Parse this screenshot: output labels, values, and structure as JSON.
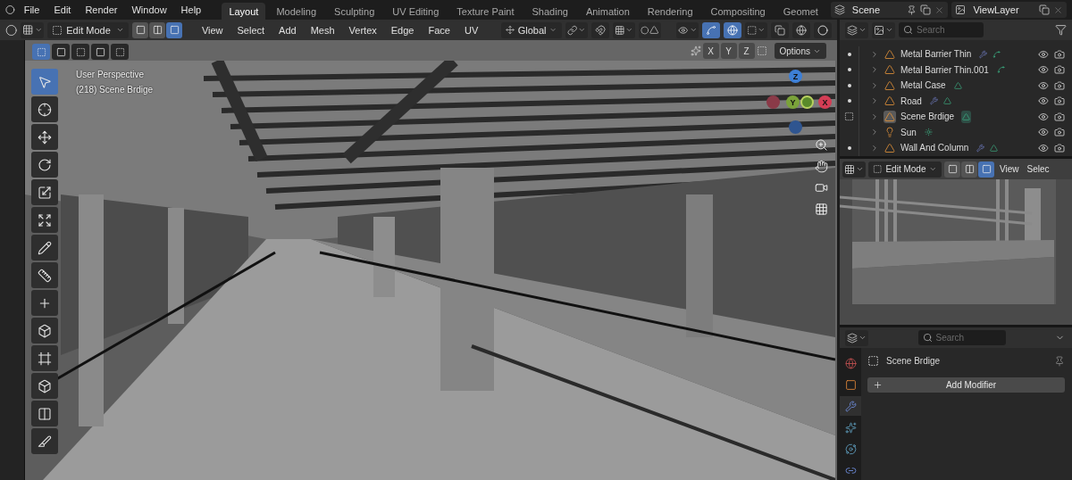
{
  "menus": [
    "File",
    "Edit",
    "Render",
    "Window",
    "Help"
  ],
  "workspaces": [
    {
      "label": "Layout",
      "selected": true
    },
    {
      "label": "Modeling",
      "selected": false
    },
    {
      "label": "Sculpting",
      "selected": false
    },
    {
      "label": "UV Editing",
      "selected": false
    },
    {
      "label": "Texture Paint",
      "selected": false
    },
    {
      "label": "Shading",
      "selected": false
    },
    {
      "label": "Animation",
      "selected": false
    },
    {
      "label": "Rendering",
      "selected": false
    },
    {
      "label": "Compositing",
      "selected": false
    },
    {
      "label": "Geomet",
      "selected": false
    }
  ],
  "scene": {
    "name": "Scene"
  },
  "view_layer": {
    "name": "ViewLayer"
  },
  "viewport_header": {
    "mode": "Edit Mode",
    "select_modes": [
      {
        "kind": "vertex",
        "selected": false
      },
      {
        "kind": "edge",
        "selected": false
      },
      {
        "kind": "face",
        "selected": true
      }
    ],
    "menus": [
      "View",
      "Select",
      "Add",
      "Mesh",
      "Vertex",
      "Edge",
      "Face",
      "UV"
    ],
    "orientation": "Global"
  },
  "viewport": {
    "view_name": "User Perspective",
    "object_label": "(218) Scene Brdige",
    "axes": [
      "X",
      "Y",
      "Z"
    ],
    "options": "Options",
    "gizmo": {
      "z": "Z",
      "y": "Y",
      "x": "X"
    },
    "tools": [
      {
        "kind": "select",
        "selected": true
      },
      {
        "kind": "cursor",
        "selected": false
      },
      {
        "kind": "move",
        "selected": false
      },
      {
        "kind": "rotate",
        "selected": false
      },
      {
        "kind": "scale",
        "selected": false
      },
      {
        "kind": "transform",
        "selected": false
      },
      {
        "kind": "annotate",
        "selected": false
      },
      {
        "kind": "measure",
        "selected": false
      },
      {
        "kind": "add",
        "selected": false
      },
      {
        "kind": "extrude",
        "selected": false
      },
      {
        "kind": "inset",
        "selected": false
      },
      {
        "kind": "bevel",
        "selected": false
      },
      {
        "kind": "loopcut",
        "selected": false
      },
      {
        "kind": "knife",
        "selected": false
      }
    ]
  },
  "outliner": {
    "search": {
      "placeholder": "Search"
    },
    "items": [
      {
        "name": "Metal Barrier Thin",
        "kind": "mesh",
        "editable": true,
        "in_edit_mode": false,
        "icons": [
          {
            "kind": "wrench"
          },
          {
            "kind": "curve"
          }
        ],
        "selected": false
      },
      {
        "name": "Metal Barrier Thin.001",
        "kind": "mesh",
        "editable": true,
        "in_edit_mode": false,
        "icons": [
          {
            "kind": "curve"
          }
        ],
        "selected": false
      },
      {
        "name": "Metal Case",
        "kind": "mesh",
        "editable": true,
        "in_edit_mode": false,
        "icons": [
          {
            "kind": "mesh"
          }
        ],
        "selected": false
      },
      {
        "name": "Road",
        "kind": "mesh",
        "editable": true,
        "in_edit_mode": false,
        "icons": [
          {
            "kind": "wrench"
          },
          {
            "kind": "mesh"
          }
        ],
        "selected": false
      },
      {
        "name": "Scene Brdige",
        "kind": "mesh",
        "editable": false,
        "in_edit_mode": true,
        "icons": [
          {
            "kind": "mesh"
          }
        ],
        "selected": true
      },
      {
        "name": "Sun",
        "kind": "light",
        "editable": false,
        "in_edit_mode": false,
        "icons": [
          {
            "kind": "sun"
          }
        ],
        "selected": false
      },
      {
        "name": "Wall And Column",
        "kind": "mesh",
        "editable": true,
        "in_edit_mode": false,
        "icons": [
          {
            "kind": "wrench"
          },
          {
            "kind": "mesh"
          }
        ],
        "selected": false
      }
    ]
  },
  "preview": {
    "mode": "Edit Mode",
    "select_modes": [
      {
        "kind": "vertex",
        "selected": false
      },
      {
        "kind": "edge",
        "selected": false
      },
      {
        "kind": "face",
        "selected": true
      }
    ],
    "menus": [
      "View",
      "Selec"
    ]
  },
  "properties": {
    "search": {
      "placeholder": "Search"
    },
    "tabs": [
      {
        "kind": "scene",
        "selected": false
      },
      {
        "kind": "object",
        "selected": false
      },
      {
        "kind": "modifier",
        "selected": true
      },
      {
        "kind": "particles",
        "selected": false
      },
      {
        "kind": "physics",
        "selected": false
      },
      {
        "kind": "constraints",
        "selected": false
      }
    ],
    "object_name": "Scene Brdige",
    "add_button": "Add Modifier"
  }
}
